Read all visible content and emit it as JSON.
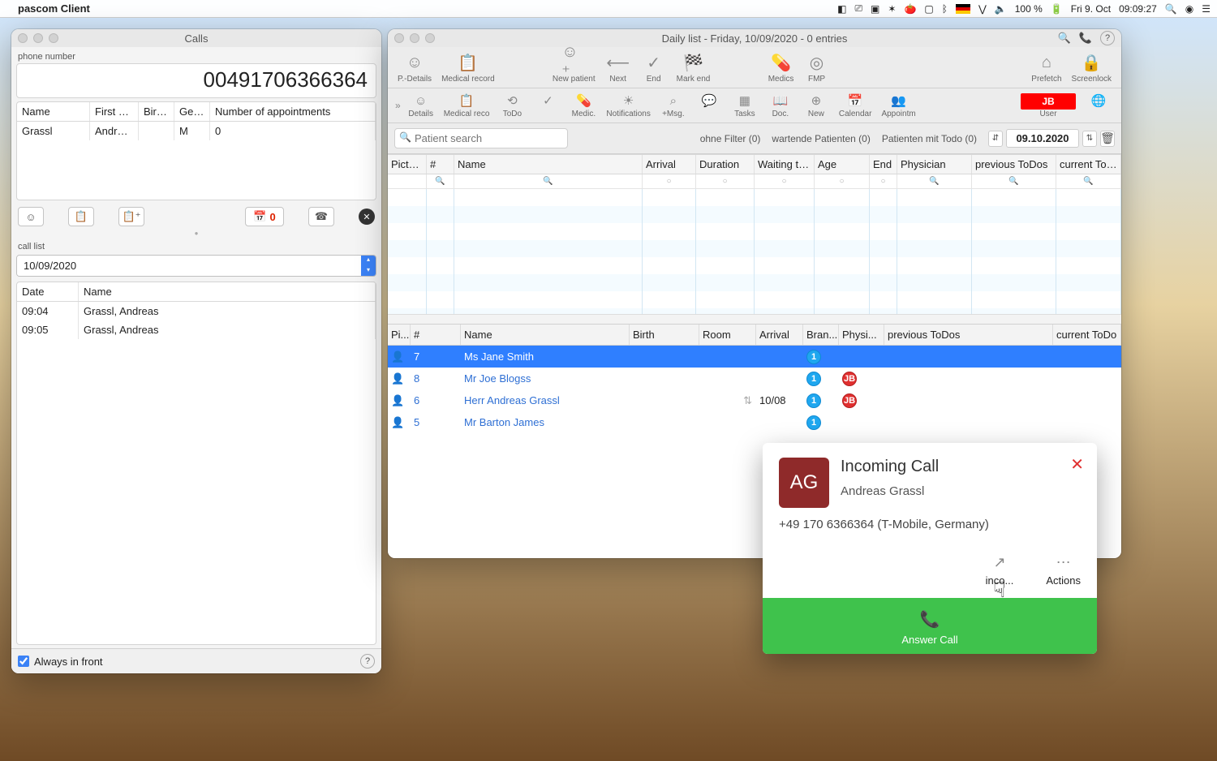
{
  "menubar": {
    "app_name": "pascom Client",
    "battery": "100 %",
    "date": "Fri 9. Oct",
    "time": "09:09:27"
  },
  "calls_window": {
    "title": "Calls",
    "field_label": "phone number",
    "phone_number": "00491706366364",
    "columns": {
      "name": "Name",
      "first": "First na...",
      "birth": "Birth...",
      "gender": "Gen...",
      "appt": "Number of appointments"
    },
    "contact": {
      "name": "Grassl",
      "first": "Andreas",
      "birth": "",
      "gender": "M",
      "appt": "0"
    },
    "cal_count": "0",
    "call_list_label": "call list",
    "date_selected": "10/09/2020",
    "list_columns": {
      "date": "Date",
      "name": "Name"
    },
    "entries": [
      {
        "date": "09:04",
        "name": "Grassl, Andreas"
      },
      {
        "date": "09:05",
        "name": "Grassl, Andreas"
      }
    ],
    "always_front": "Always in front"
  },
  "daily_window": {
    "title": "Daily list - Friday, 10/09/2020 - 0 entries",
    "toolbar1": [
      "P.-Details",
      "Medical record",
      "",
      "New patient",
      "Next",
      "End",
      "Mark end",
      "",
      "Medics",
      "FMP",
      "",
      "Prefetch",
      "Screenlock"
    ],
    "toolbar2": [
      "Details",
      "Medical reco",
      "",
      "ToDo",
      "",
      "Medic.",
      "",
      "Notifications",
      "",
      "+Msg.",
      "",
      "Tasks",
      "Doc.",
      "",
      "New",
      "Calendar",
      "Appointm",
      "",
      "User",
      ""
    ],
    "user_badge": "JB",
    "search_placeholder": "Patient search",
    "filter1": "ohne Filter (0)",
    "filter2": "wartende Patienten (0)",
    "filter3": "Patienten mit Todo (0)",
    "date": "09.10.2020",
    "grid_cols": [
      "Picture",
      "#",
      "Name",
      "Arrival",
      "Duration",
      "Waiting time",
      "Age",
      "End",
      "Physician",
      "previous ToDos",
      "current ToDo"
    ],
    "pt_cols": [
      "Pi...",
      "#",
      "Name",
      "Birth",
      "Room",
      "Arrival",
      "Bran...",
      "Physi...",
      "previous ToDos",
      "current ToDo"
    ],
    "patients": [
      {
        "num": "7",
        "name": "Ms Jane Smith",
        "arrival": "",
        "bran": "1",
        "phy": ""
      },
      {
        "num": "8",
        "name": "Mr Joe Blogss",
        "arrival": "",
        "bran": "1",
        "phy": "JB"
      },
      {
        "num": "6",
        "name": "Herr Andreas Grassl",
        "arrival": "10/08",
        "bran": "1",
        "phy": "JB"
      },
      {
        "num": "5",
        "name": "Mr Barton James",
        "arrival": "",
        "bran": "1",
        "phy": ""
      }
    ]
  },
  "call_popup": {
    "avatar": "AG",
    "title": "Incoming Call",
    "name": "Andreas Grassl",
    "number": "+49 170 6366364 (T-Mobile, Germany)",
    "inco": "inco...",
    "actions": "Actions",
    "answer": "Answer Call"
  }
}
